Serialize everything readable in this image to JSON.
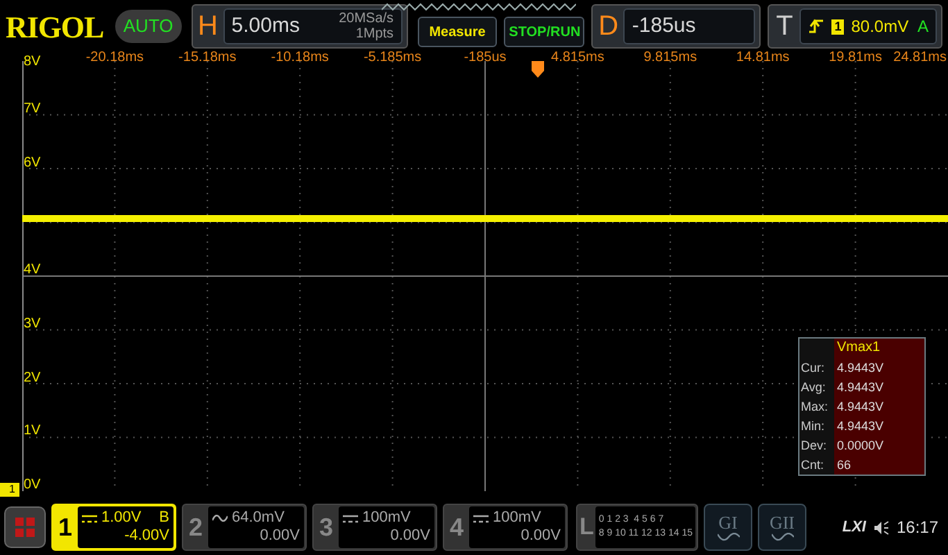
{
  "top_bar": {
    "logo": "RIGOL",
    "mode": "AUTO",
    "horizontal": {
      "key": "H",
      "timebase": "5.00ms",
      "sample_rate": "20MSa/s",
      "memory_depth": "1Mpts"
    },
    "buttons": [
      "Measure",
      "STOP/RUN"
    ],
    "delay": {
      "key": "D",
      "value": "-185us"
    },
    "trigger": {
      "key": "T",
      "source": "1",
      "level": "80.0mV",
      "sweep": "A"
    }
  },
  "time_labels": [
    "-20.18ms",
    "-15.18ms",
    "-10.18ms",
    "-5.185ms",
    "-185us",
    "4.815ms",
    "9.815ms",
    "14.81ms",
    "19.81ms",
    "24.81ms"
  ],
  "volt_labels": [
    "8V",
    "7V",
    "6V",
    "4V",
    "3V",
    "2V",
    "1V",
    "0V"
  ],
  "ground_marker": "1",
  "measurement": {
    "title": "Vmax1",
    "rows": [
      {
        "label": "Cur:",
        "value": "4.9443V"
      },
      {
        "label": "Avg:",
        "value": "4.9443V"
      },
      {
        "label": "Max:",
        "value": "4.9443V"
      },
      {
        "label": "Min:",
        "value": "4.9443V"
      },
      {
        "label": "Dev:",
        "value": "0.0000V"
      },
      {
        "label": "Cnt:",
        "value": "66"
      }
    ]
  },
  "channels": [
    {
      "number": "1",
      "kind": "dc",
      "scale": "1.00V",
      "offset": "-4.00V",
      "flag": "B",
      "selected": true
    },
    {
      "number": "2",
      "kind": "ac",
      "scale": "64.0mV",
      "offset": "0.00V",
      "selected": false
    },
    {
      "number": "3",
      "kind": "dc",
      "scale": "100mV",
      "offset": "0.00V",
      "selected": false
    },
    {
      "number": "4",
      "kind": "dc",
      "scale": "100mV",
      "offset": "0.00V",
      "selected": false
    }
  ],
  "logic": {
    "key": "L",
    "bits_row_1": "0 1 2 3  4 5 6 7",
    "bits_row_2": "8 9 10 11 12 13 14 15"
  },
  "generators": [
    "GI",
    "GII"
  ],
  "status": {
    "lxi": "LXI",
    "time": "16:17"
  }
}
